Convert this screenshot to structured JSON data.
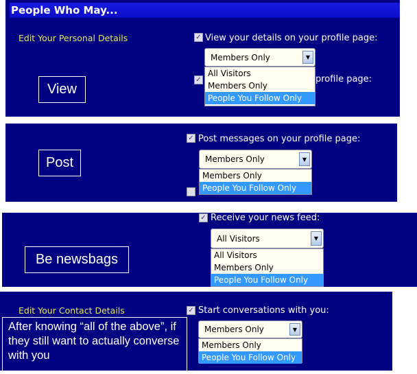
{
  "panel1": {
    "header": "People Who May...",
    "section": "Edit Your Personal Details",
    "setting_label": "View your details on your profile page:",
    "behind_label": "profile page:",
    "selected": "Members Only",
    "options": [
      "All Visitors",
      "Members Only",
      "People You Follow Only"
    ],
    "note": "View"
  },
  "panel2": {
    "setting_label": "Post messages on your profile page:",
    "selected": "Members Only",
    "options": [
      "Members Only",
      "People You Follow Only"
    ],
    "note": "Post"
  },
  "panel3": {
    "setting_label": "Receive your news feed:",
    "selected": "All Visitors",
    "options": [
      "All Visitors",
      "Members Only",
      "People You Follow Only"
    ],
    "note": "Be newsbags"
  },
  "panel4": {
    "section": "Edit Your Contact Details",
    "setting_label": "Start conversations with you:",
    "selected": "Members Only",
    "options": [
      "Members Only",
      "People You Follow Only"
    ],
    "note": "After knowing “all of the above”, if they still want to actually converse with you"
  },
  "colors": {
    "panel_bg": "#000080",
    "highlight": "#3399ff",
    "section_text": "#e8e860"
  }
}
